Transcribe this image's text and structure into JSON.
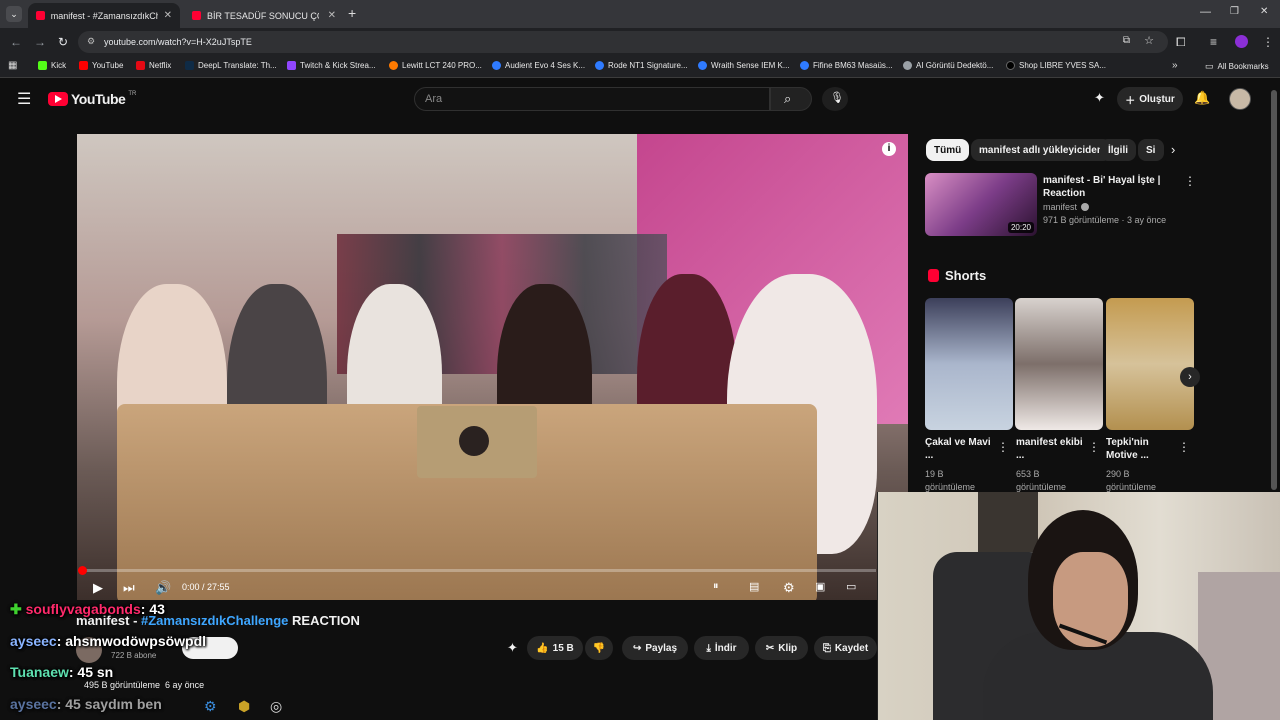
{
  "browser": {
    "tabs": [
      {
        "title": "manifest - #ZamansızdıkChalle",
        "active": true
      },
      {
        "title": "BİR TESADÜF SONUCU ÇÖZÜLMÜ",
        "active": false
      }
    ],
    "url": "youtube.com/watch?v=H-X2uJTspTE",
    "bookmarks": [
      {
        "label": "Kick",
        "color": "#53fc18"
      },
      {
        "label": "YouTube",
        "color": "#ff0000"
      },
      {
        "label": "Netflix",
        "color": "#e50914"
      },
      {
        "label": "DeepL Translate: Th...",
        "color": "#0f2b46"
      },
      {
        "label": "Twitch & Kick Strea...",
        "color": "#9146ff"
      },
      {
        "label": "Lewitt LCT 240 PRO...",
        "color": "#ff7a00"
      },
      {
        "label": "Audient Evo 4 Ses K...",
        "color": "#2f7bff"
      },
      {
        "label": "Rode NT1 Signature...",
        "color": "#2f7bff"
      },
      {
        "label": "Wraith Sense IEM K...",
        "color": "#2f7bff"
      },
      {
        "label": "Fifine BM63 Masaüs...",
        "color": "#2f7bff"
      },
      {
        "label": "AI Görüntü Dedektö...",
        "color": "#9aa0a6"
      },
      {
        "label": "Shop LIBRE YVES SA...",
        "color": "#000000"
      }
    ],
    "all_bookmarks": "All Bookmarks"
  },
  "youtube": {
    "logo": "YouTube",
    "logo_region": "TR",
    "search_placeholder": "Ara",
    "create_label": "Oluştur"
  },
  "video": {
    "time": "0:00 / 27:55",
    "progress": 0.0,
    "title_prefix": "manifest - ",
    "title_tag": "#ZamansızdıkChallenge",
    "title_suffix": " REACTION",
    "subscribers": "722 B abone",
    "likes": "15 B",
    "share": "Paylaş",
    "download": "İndir",
    "clip": "Klip",
    "save": "Kaydet",
    "views_meta": "495 B görüntüleme  6 ay önce"
  },
  "sidebar": {
    "chips": [
      "Tümü",
      "manifest adlı yükleyiciden",
      "İlgili",
      "Si"
    ],
    "recommended": {
      "title_line1": "manifest - Bi' Hayal İşte |",
      "title_line2": "Reaction",
      "channel": "manifest",
      "meta": "971 B görüntüleme · 3 ay önce",
      "duration": "20:20"
    },
    "shorts_heading": "Shorts",
    "shorts": [
      {
        "title": "Çakal ve Mavi ...",
        "views": "19 B görüntüleme"
      },
      {
        "title": "manifest ekibi ...",
        "views": "653 B görüntüleme"
      },
      {
        "title": "Tepki'nin Motive ...",
        "views": "290 B görüntüleme"
      }
    ]
  },
  "chat": [
    {
      "name": "souflyvagabonds",
      "msg": ": 43",
      "color": "#ff2a6b",
      "badge": true
    },
    {
      "name": "ayseec",
      "msg": ": ahsmwodöwpsöwpdl",
      "color": "#8ab4ff",
      "badge": false
    },
    {
      "name": "Tuanaew",
      "msg": ": 45 sn",
      "color": "#5ee0b0",
      "badge": false
    },
    {
      "name": "ayseec",
      "msg": ": 45 saydım ben",
      "color": "#8ab4ff",
      "badge": false
    }
  ]
}
